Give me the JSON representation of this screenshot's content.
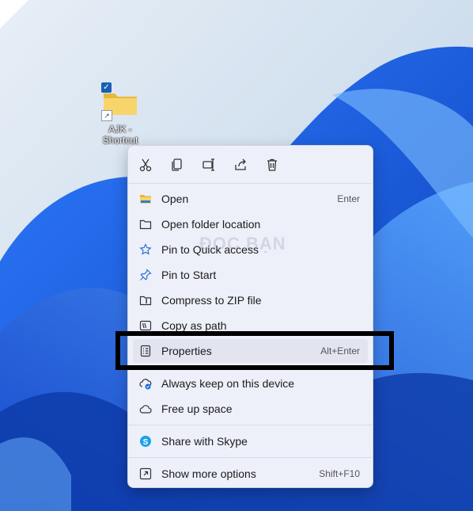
{
  "desktop": {
    "shortcut_label": "AJK - Shortcut"
  },
  "watermark": "ĐỌC BẠN",
  "context_menu": {
    "quick_actions": [
      {
        "name": "cut",
        "icon": "scissors-icon"
      },
      {
        "name": "copy",
        "icon": "copy-icon"
      },
      {
        "name": "rename",
        "icon": "rename-icon"
      },
      {
        "name": "share",
        "icon": "share-icon"
      },
      {
        "name": "delete",
        "icon": "trash-icon"
      }
    ],
    "items": [
      {
        "label": "Open",
        "shortcut": "Enter",
        "icon": "folder-open-icon"
      },
      {
        "label": "Open folder location",
        "shortcut": "",
        "icon": "folder-icon"
      },
      {
        "label": "Pin to Quick access",
        "shortcut": "",
        "icon": "star-icon"
      },
      {
        "label": "Pin to Start",
        "shortcut": "",
        "icon": "pin-icon"
      },
      {
        "label": "Compress to ZIP file",
        "shortcut": "",
        "icon": "zip-icon"
      },
      {
        "label": "Copy as path",
        "shortcut": "",
        "icon": "path-icon"
      },
      {
        "label": "Properties",
        "shortcut": "Alt+Enter",
        "icon": "properties-icon"
      },
      {
        "label": "Always keep on this device",
        "shortcut": "",
        "icon": "cloud-sync-icon"
      },
      {
        "label": "Free up space",
        "shortcut": "",
        "icon": "cloud-icon"
      },
      {
        "label": "Share with Skype",
        "shortcut": "",
        "icon": "skype-icon"
      },
      {
        "label": "Show more options",
        "shortcut": "Shift+F10",
        "icon": "more-options-icon"
      }
    ]
  },
  "colors": {
    "accent": "#1a5fb4",
    "wallpaper_blue": "#1f5fe0",
    "menu_bg": "#eef0f9"
  }
}
